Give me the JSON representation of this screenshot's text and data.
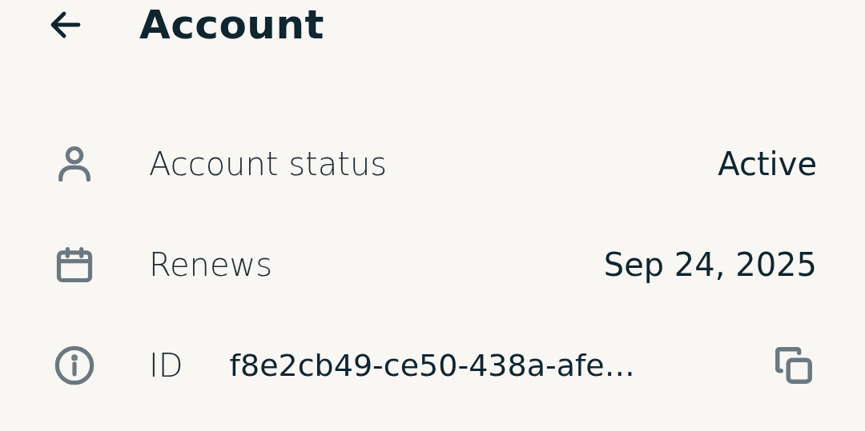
{
  "header": {
    "title": "Account"
  },
  "rows": [
    {
      "kind": "status",
      "label": "Account status",
      "value": "Active"
    },
    {
      "kind": "date",
      "label": "Renews",
      "value": "Sep 24, 2025"
    },
    {
      "kind": "id",
      "label": "ID",
      "value": "f8e2cb49-ce50-438a-afe…"
    }
  ]
}
